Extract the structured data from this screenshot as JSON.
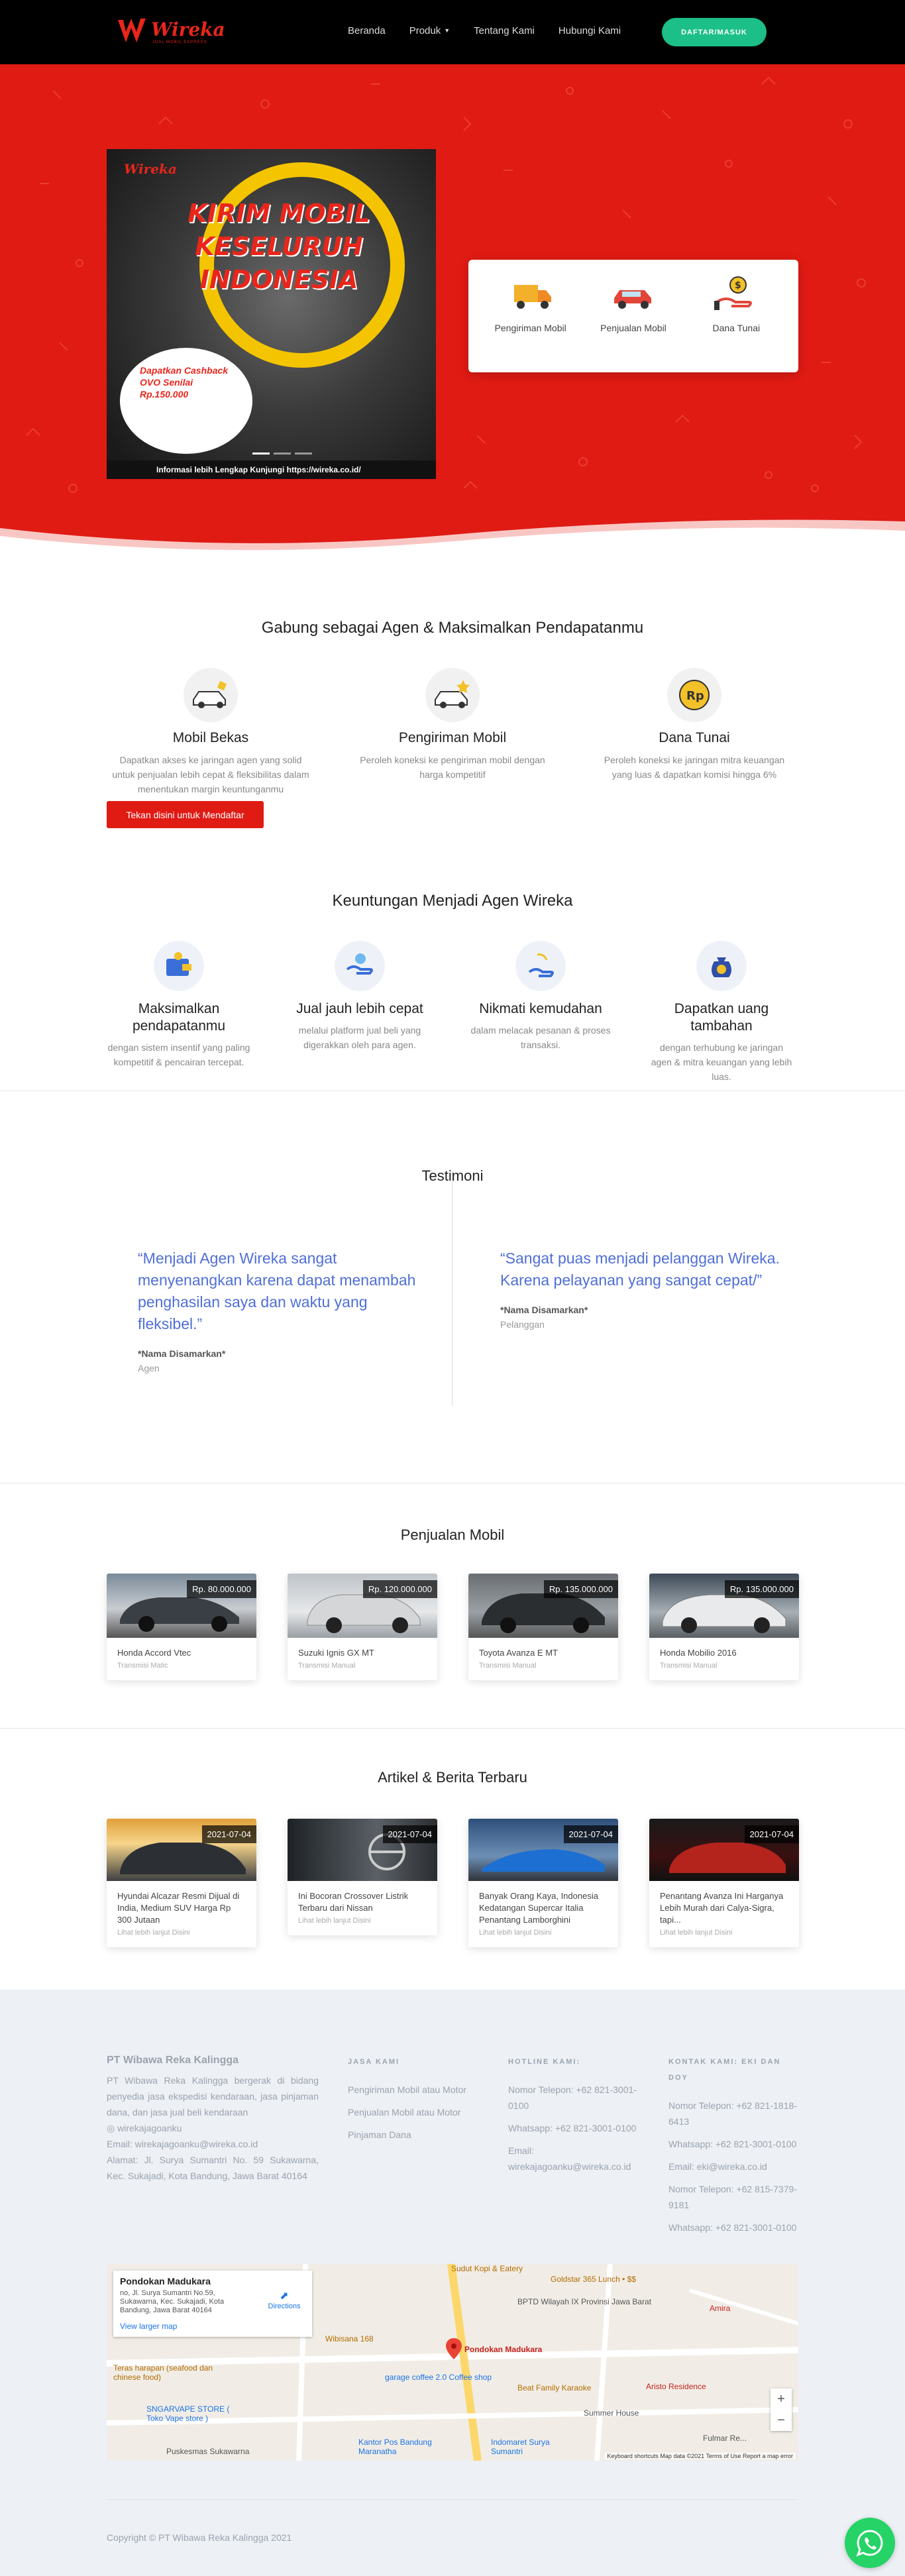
{
  "nav": {
    "logo_text": "Wireka",
    "logo_sub": "JUAL MOBIL EXPRESS",
    "links": [
      "Beranda",
      "Produk",
      "Tentang Kami",
      "Hubungi Kami"
    ],
    "login_label": "DAFTAR/MASUK"
  },
  "hero": {
    "banner_logo": "Wireka",
    "banner_title": "KIRIM MOBIL KESELURUH INDONESIA",
    "banner_badge": "Dapatkan Cashback OVO Senilai Rp.150.000",
    "banner_footer": "Informasi lebih Lengkap Kunjungi https://wireka.co.id/",
    "services": [
      {
        "label": "Pengiriman Mobil",
        "icon": "truck-icon"
      },
      {
        "label": "Penjualan Mobil",
        "icon": "car-icon"
      },
      {
        "label": "Dana Tunai",
        "icon": "money-hand-icon"
      }
    ]
  },
  "agent": {
    "title": "Gabung sebagai Agen & Maksimalkan Pendapatanmu",
    "items": [
      {
        "title": "Mobil Bekas",
        "desc": "Dapatkan akses ke jaringan agen yang solid untuk penjualan lebih cepat & fleksibilitas dalam menentukan margin keuntunganmu"
      },
      {
        "title": "Pengiriman Mobil",
        "desc": "Peroleh koneksi ke pengiriman mobil dengan harga kompetitif"
      },
      {
        "title": "Dana Tunai",
        "desc": "Peroleh koneksi ke jaringan mitra keuangan yang luas & dapatkan komisi hingga 6%"
      }
    ],
    "cta": "Tekan disini untuk Mendaftar"
  },
  "benefits": {
    "title": "Keuntungan Menjadi Agen Wireka",
    "items": [
      {
        "title": "Maksimalkan pendapatanmu",
        "desc": "dengan sistem insentif yang paling kompetitif & pencairan tercepat."
      },
      {
        "title": "Jual jauh lebih cepat",
        "desc": "melalui platform jual beli yang digerakkan oleh para agen."
      },
      {
        "title": "Nikmati kemudahan",
        "desc": "dalam melacak pesanan & proses transaksi."
      },
      {
        "title": "Dapatkan uang tambahan",
        "desc": "dengan terhubung ke jaringan agen & mitra keuangan yang lebih luas."
      }
    ]
  },
  "testimonials": {
    "title": "Testimoni",
    "items": [
      {
        "quote": "“Menjadi Agen Wireka sangat menyenangkan karena dapat menambah penghasilan saya dan waktu yang fleksibel.”",
        "name": "*Nama Disamarkan*",
        "role": "Agen"
      },
      {
        "quote": "“Sangat puas menjadi pelanggan Wireka. Karena pelayanan yang sangat cepat/”",
        "name": "*Nama Disamarkan*",
        "role": "Pelanggan"
      }
    ]
  },
  "sales": {
    "title": "Penjualan Mobil",
    "cars": [
      {
        "price": "Rp. 80.000.000",
        "name": "Honda Accord Vtec",
        "trans": "Transmisi Matic"
      },
      {
        "price": "Rp. 120.000.000",
        "name": "Suzuki Ignis GX MT",
        "trans": "Transmisi Manual"
      },
      {
        "price": "Rp. 135.000.000",
        "name": "Toyota Avanza E MT",
        "trans": "Transmisi Manual"
      },
      {
        "price": "Rp. 135.000.000",
        "name": "Honda Mobilio 2016",
        "trans": "Transmisi Manual"
      }
    ]
  },
  "articles": {
    "title": "Artikel & Berita Terbaru",
    "items": [
      {
        "date": "2021-07-04",
        "title": "Hyundai Alcazar Resmi Dijual di India, Medium SUV Harga Rp 300 Jutaan",
        "more": "Lihat lebih lanjut Disini"
      },
      {
        "date": "2021-07-04",
        "title": "Ini Bocoran Crossover Listrik Terbaru dari Nissan",
        "more": "Lihat lebih lanjut Disini"
      },
      {
        "date": "2021-07-04",
        "title": "Banyak Orang Kaya, Indonesia Kedatangan Supercar Italia Penantang Lamborghini",
        "more": "Lihat lebih lanjut Disini"
      },
      {
        "date": "2021-07-04",
        "title": "Penantang Avanza Ini Harganya Lebih Murah dari Calya-Sigra, tapi...",
        "more": "Lihat lebih lanjut Disini"
      }
    ]
  },
  "footer": {
    "brand": "PT Wibawa Reka Kalingga",
    "about": "PT Wibawa Reka Kalingga bergerak di bidang penyedia jasa ekspedisi kendaraan, jasa pinjaman dana, dan jasa jual beli kendaraan",
    "instagram": "wirekajagoanku",
    "email": "Email: wirekajagoanku@wireka.co.id",
    "address": "Alamat: Jl. Surya Sumantri No. 59 Sukawarna, Kec. Sukajadi, Kota Bandung, Jawa Barat 40164",
    "jasa_head": "JASA KAMI",
    "jasa": [
      "Pengiriman Mobil atau Motor",
      "Penjualan Mobil atau Motor",
      "Pinjaman Dana"
    ],
    "hotline_head": "HOTLINE KAMI:",
    "hotline": [
      "Nomor Telepon: +62 821-3001-0100",
      "Whatsapp: +62 821-3001-0100",
      "Email: wirekajagoanku@wireka.co.id"
    ],
    "kontak_head": "KONTAK KAMI: EKI DAN DOY",
    "kontak": [
      "Nomor Telepon: +62 821-1818-6413",
      "Whatsapp: +62 821-3001-0100",
      "Email: eki@wireka.co.id",
      "Nomor Telepon: +62 815-7379-9181",
      "Whatsapp: +62 821-3001-0100"
    ],
    "copyright": "Copyright © PT Wibawa Reka Kalingga 2021"
  },
  "map": {
    "place": "Pondokan Madukara",
    "addr": "no, Jl. Surya Sumantri No.59, Sukawarna, Kec. Sukajadi, Kota Bandung, Jawa Barat 40164",
    "directions": "Directions",
    "view_larger": "View larger map",
    "labels": [
      "Sudut Kopi & Eatery",
      "Goldstar 365 Lunch • $$",
      "BPTD Wilayah IX Provinsi Jawa Barat",
      "Wibisana 168",
      "Pondokan Madukara",
      "Amira",
      "garage coffee 2.0 Coffee shop",
      "Beat Family Karaoke",
      "Aristo Residence",
      "Teras harapan (seafood dan chinese food)",
      "SNGARVAPE STORE ( Toko Vape store )",
      "Summer House",
      "Puskesmas Sukawarna",
      "Kantor Pos Bandung Maranatha",
      "Indomaret Surya Sumantri",
      "Fulmar Re..."
    ],
    "footer": "Keyboard shortcuts   Map data ©2021   Terms of Use   Report a map error"
  }
}
